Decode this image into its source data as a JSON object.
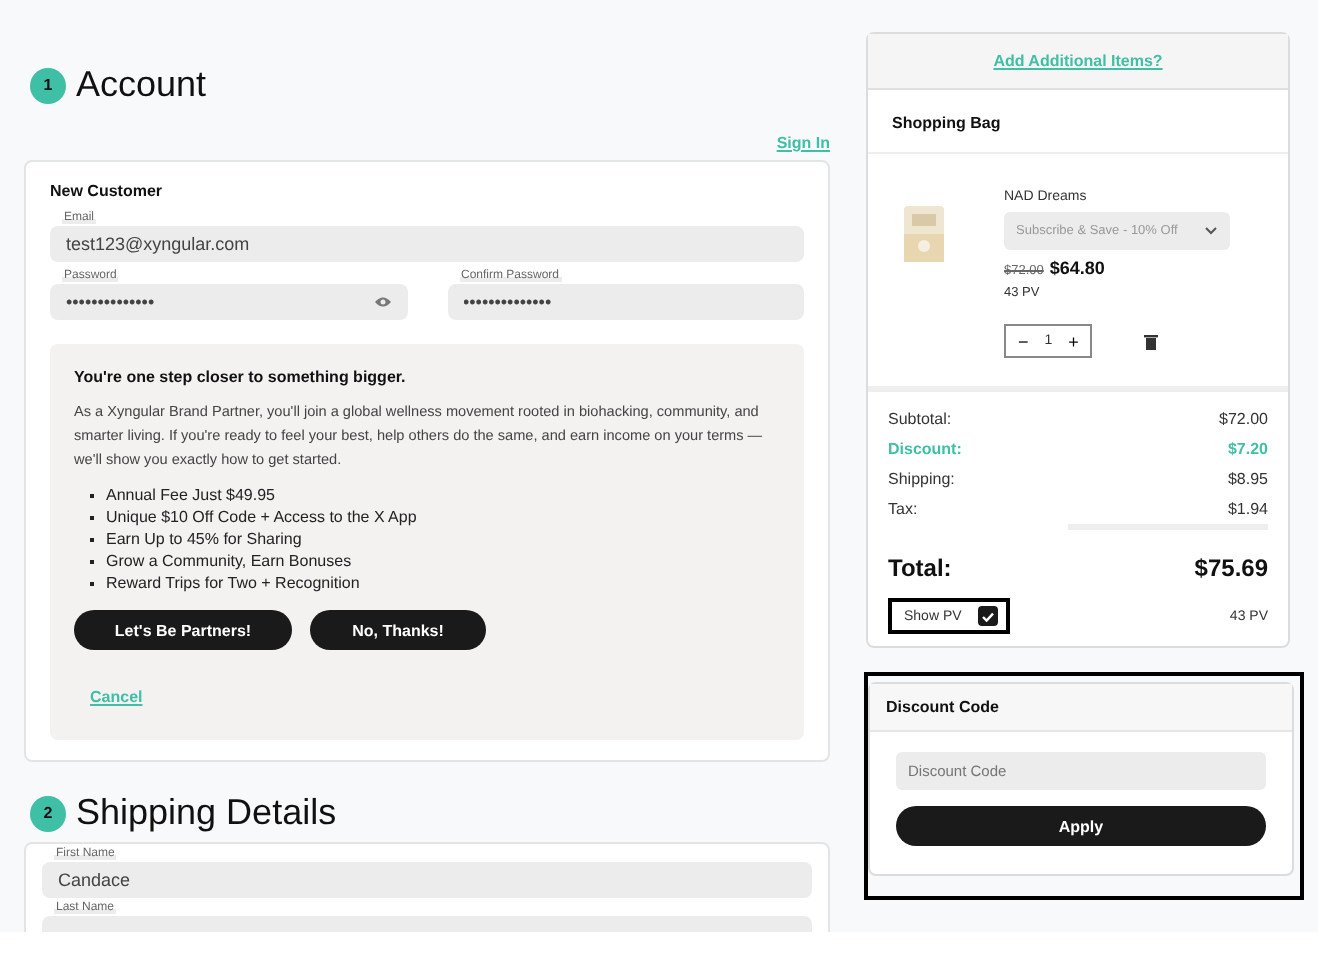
{
  "account": {
    "step": "1",
    "title": "Account",
    "sign_in": "Sign In",
    "card_title": "New Customer",
    "email": {
      "label": "Email",
      "value": "test123@xyngular.com"
    },
    "password": {
      "label": "Password",
      "value": "••••••••••••••"
    },
    "confirm_password": {
      "label": "Confirm Password",
      "value": "••••••••••••••"
    },
    "promo": {
      "heading": "You're one step closer to something bigger.",
      "body": "As a Xyngular Brand Partner, you'll join a global wellness movement rooted in biohacking, community, and smarter living. If you're ready to feel your best, help others do the same, and earn income on your terms — we'll show you exactly how to get started.",
      "bullets": [
        "Annual Fee Just $49.95",
        "Unique $10 Off Code + Access to the X App",
        "Earn Up to 45% for Sharing",
        "Grow a Community, Earn Bonuses",
        "Reward Trips for Two + Recognition"
      ],
      "buttons": [
        "Let's Be Partners!",
        "No, Thanks!"
      ],
      "cancel": "Cancel"
    }
  },
  "shipping": {
    "step": "2",
    "title": "Shipping Details",
    "fields": [
      {
        "label": "First Name",
        "value": "Candace"
      },
      {
        "label": "Last Name"
      }
    ]
  },
  "cart": {
    "add_link": "Add Additional Items?",
    "title": "Shopping Bag",
    "item": {
      "kind": "picture",
      "name": "NAD Dreams",
      "option": "Subscribe & Save - 10% Off",
      "old_price": "$72.00",
      "price": "$64.80",
      "pv": "43 PV",
      "quantity": "1",
      "minus": "−",
      "plus": "+"
    },
    "summary": [
      {
        "label": "Subtotal:",
        "value": "$72.00",
        "kind": "plain"
      },
      {
        "label": "Discount:",
        "value": "$7.20",
        "kind": "discount"
      },
      {
        "label": "Shipping:",
        "value": "$8.95",
        "kind": "plain"
      },
      {
        "label": "Tax:",
        "value": "$1.94",
        "kind": "plain"
      }
    ],
    "total": {
      "label": "Total:",
      "value": "$75.69"
    },
    "show_pv": {
      "label": "Show PV",
      "checked": true,
      "highlighted": true,
      "value": "43 PV"
    }
  },
  "discount": {
    "title": "Discount Code",
    "placeholder": "Discount Code",
    "button": "Apply",
    "highlighted": true
  }
}
